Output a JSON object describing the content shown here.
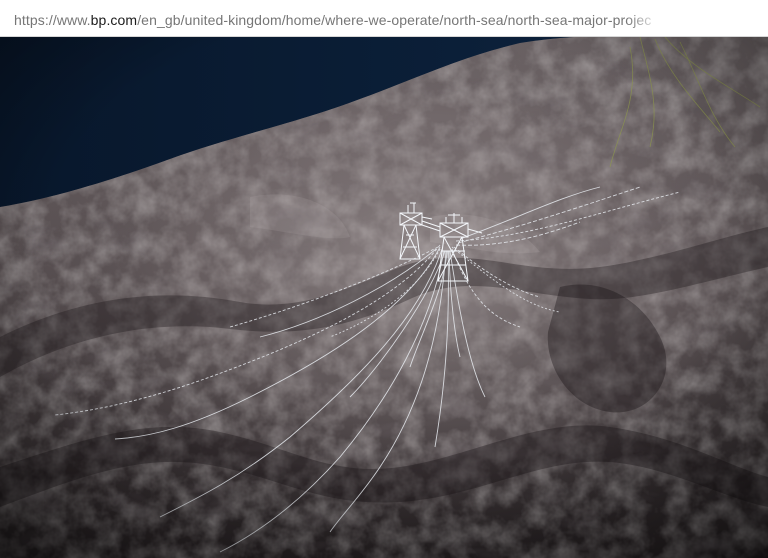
{
  "browser": {
    "url_scheme": "https://www.",
    "url_host": "bp.com",
    "url_path": "/en_gb/united-kingdom/home/where-we-operate/north-sea/north-sea-major-projec"
  },
  "scene": {
    "description_icon": "seabed-platform-icon"
  }
}
